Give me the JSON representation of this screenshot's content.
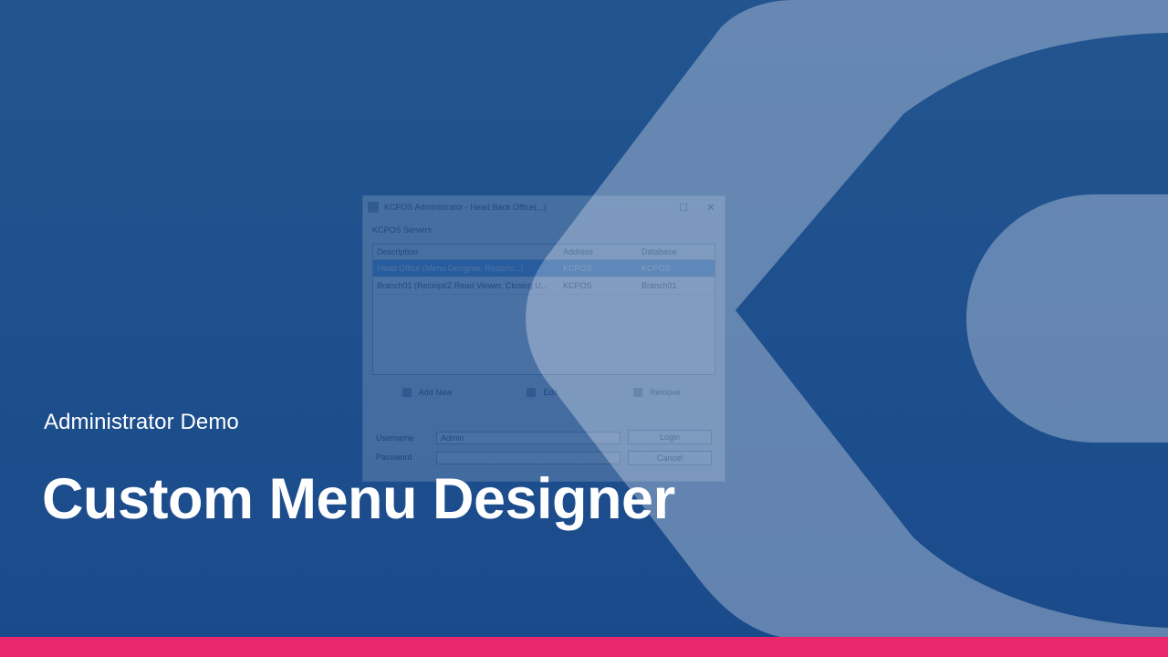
{
  "colors": {
    "background": "#1e4f8d",
    "logo": "#a9bbd6",
    "bottom_bar": "#e8286a",
    "text": "#ffffff"
  },
  "app_window": {
    "title": "KCPOS Administrator - Head Back Office(...)",
    "group_label": "KCPOS Servers",
    "columns": [
      "Description",
      "Address",
      "Database"
    ],
    "rows": [
      [
        "Head Office (Menu Designer, Reports...)",
        "KCPOS",
        "KCPOS"
      ],
      [
        "Branch01 (Receipt/Z Read Viewer, Closing U...",
        "KCPOS",
        "Branch01"
      ]
    ],
    "add_new_label": "Add New",
    "edit_label": "Edit",
    "remove_label": "Remove",
    "username_label": "Username",
    "password_label": "Password",
    "username_value": "Admin",
    "login_label": "Login",
    "cancel_label": "Cancel"
  },
  "subtitle": "Administrator Demo",
  "title": "Custom Menu Designer"
}
